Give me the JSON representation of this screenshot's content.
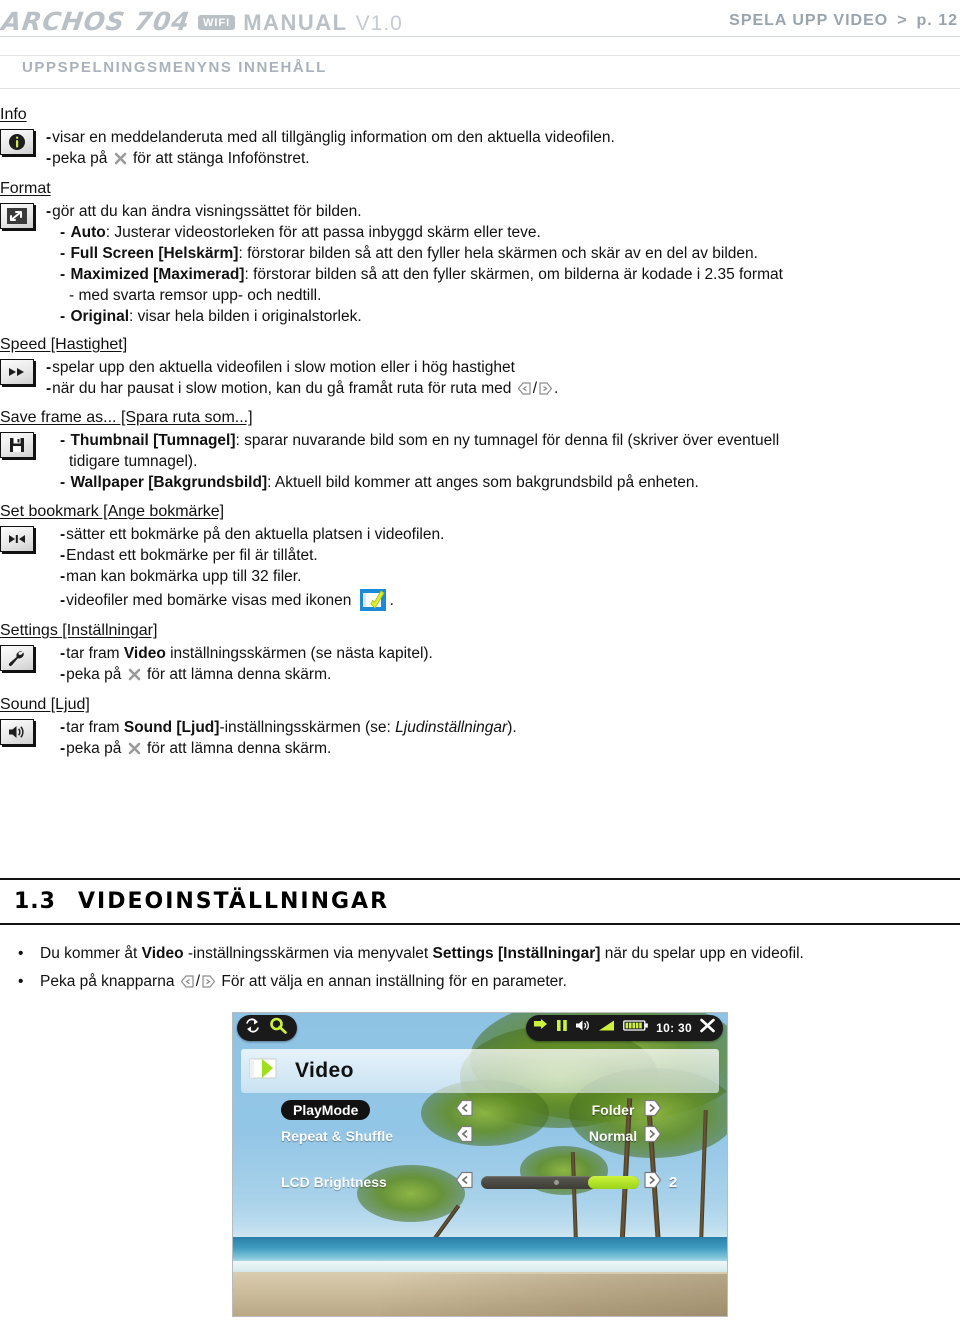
{
  "header": {
    "brand": "ARCHOS 704",
    "wifi_badge": "WIFI",
    "manual": "MANUAL",
    "version": "V1.0",
    "right_section": "SPELA UPP VIDEO",
    "right_arrow": ">",
    "right_page": "p. 12"
  },
  "section_bar": {
    "label": "UPPSPELNINGSMENYNS INNEHÅLL"
  },
  "blocks": [
    {
      "title": "Info",
      "icon": "info-icon",
      "lines": [
        {
          "dash": "-",
          "text": "visar en meddelanderuta med all tillgänglig information om den aktuella videofilen."
        },
        {
          "dash": "-",
          "text_before": "peka på ",
          "glyph": "close-x-icon",
          "text_after": " för att stänga Infofönstret."
        }
      ]
    },
    {
      "title": "Format",
      "icon": "format-resize-icon",
      "lines": [
        {
          "dash": "-",
          "text": "gör att du kan ändra visningssättet för bilden."
        },
        {
          "dash": "-",
          "bold": "Auto",
          "text": ": Justerar videostorleken för att passa inbyggd skärm eller teve."
        },
        {
          "dash": "-",
          "bold": "Full Screen [Helskärm]",
          "text": ": förstorar bilden så att den fyller hela skärmen och skär av en del av bilden."
        },
        {
          "dash": "-",
          "bold": "Maximized [Maximerad]",
          "text": ": förstorar bilden så att den fyller skärmen, om bilderna är kodade i 2.35 format"
        },
        {
          "continuation": "- med svarta remsor upp- och nedtill."
        },
        {
          "dash": "-",
          "bold": "Original",
          "text": ": visar hela bilden i originalstorlek."
        }
      ]
    },
    {
      "title": "Speed [Hastighet]",
      "icon": "fast-forward-icon",
      "lines": [
        {
          "dash": "-",
          "text": "spelar upp den aktuella videofilen i slow motion eller i hög hastighet"
        },
        {
          "dash": "-",
          "text_before": "när du har pausat i slow motion, kan du gå framåt ruta för ruta med ",
          "glyph": "arrow-left-right-pair-icon",
          "text_after": "."
        }
      ]
    },
    {
      "title": "Save frame as... [Spara ruta som...]",
      "icon": "save-floppy-icon",
      "lines": [
        {
          "dash": "-",
          "bold": "Thumbnail [Tumnagel]",
          "text": ": sparar nuvarande bild som en ny tumnagel för denna fil (skriver över eventuell"
        },
        {
          "continuation": "tidigare tumnagel)."
        },
        {
          "dash": "-",
          "bold": "Wallpaper [Bakgrundsbild]",
          "text": ": Aktuell bild kommer att anges som bakgrundsbild på enheten."
        }
      ]
    },
    {
      "title": "Set bookmark [Ange bokmärke]",
      "icon": "bookmark-skip-icon",
      "lines": [
        {
          "dash": "-",
          "text": "sätter ett bokmärke på den aktuella platsen i videofilen."
        },
        {
          "dash": "-",
          "text": "Endast ett bokmärke per fil är tillåtet."
        },
        {
          "dash": "-",
          "text": "man kan bokmärka upp till 32 filer."
        },
        {
          "dash": "-",
          "text_before": "videofiler med bomärke visas med ikonen ",
          "glyph": "bookmark-file-icon",
          "text_after": "."
        }
      ]
    },
    {
      "title": "Settings [Inställningar]",
      "icon": "wrench-settings-icon",
      "lines": [
        {
          "dash": "-",
          "text_before": "tar fram ",
          "bold": "Video",
          "text_after": " inställningsskärmen (se nästa kapitel)."
        },
        {
          "dash": "-",
          "text_before": "peka på ",
          "glyph": "close-x-icon",
          "text_after": " för att lämna denna skärm."
        }
      ]
    },
    {
      "title": "Sound [Ljud]",
      "icon": "speaker-sound-icon",
      "lines": [
        {
          "dash": "-",
          "text_before": "tar fram ",
          "bold": "Sound [Ljud]",
          "text_mid": "-inställningsskärmen (se: ",
          "italic": "Ljudinställningar",
          "text_after": ")."
        },
        {
          "dash": "-",
          "text_before": "peka på ",
          "glyph": "close-x-icon",
          "text_after": " för att lämna denna skärm."
        }
      ]
    }
  ],
  "chapter": {
    "number": "1.3",
    "name": "VIDEOINSTÄLLNINGAR",
    "bullets": [
      {
        "dot": "•",
        "part1": "Du kommer åt ",
        "bold1": "Video",
        "part2": " -inställningsskärmen via menyvalet ",
        "bold2": "Settings [Inställningar]",
        "part3": " när du spelar upp en videofil."
      },
      {
        "dot": "•",
        "part1": "Peka på knapparna ",
        "glyph": "arrow-left-right-pair-icon",
        "part3": " För att välja en annan inställning för en parameter."
      }
    ]
  },
  "device_screenshot": {
    "topbar": {
      "left_icons": [
        "repeat-icon",
        "settings-gear-icon"
      ],
      "right_icons": [
        "fast-forward-icon",
        "pause-icon",
        "volume-icon",
        "signal-icon",
        "battery-icon"
      ],
      "time": "10: 30",
      "close_icon": "close-x-icon"
    },
    "selected_title": "Video",
    "selected_title_icon": "video-play-icon",
    "options": [
      {
        "label": "PlayMode",
        "selected": true,
        "value": "Folder"
      },
      {
        "label": "Repeat & Shuffle",
        "selected": false,
        "value": "Normal"
      }
    ],
    "slider_option": {
      "label": "LCD Brightness",
      "value": "2",
      "fill_percent": 32
    }
  },
  "colors": {
    "header_grey": "#b9c0c6",
    "header_right_grey": "#9aa4ad",
    "section_label_grey": "#a9b2ba",
    "body_text": "#111111",
    "device_accent_green": "#b4e61a",
    "device_sky": "#8ec3e4"
  }
}
